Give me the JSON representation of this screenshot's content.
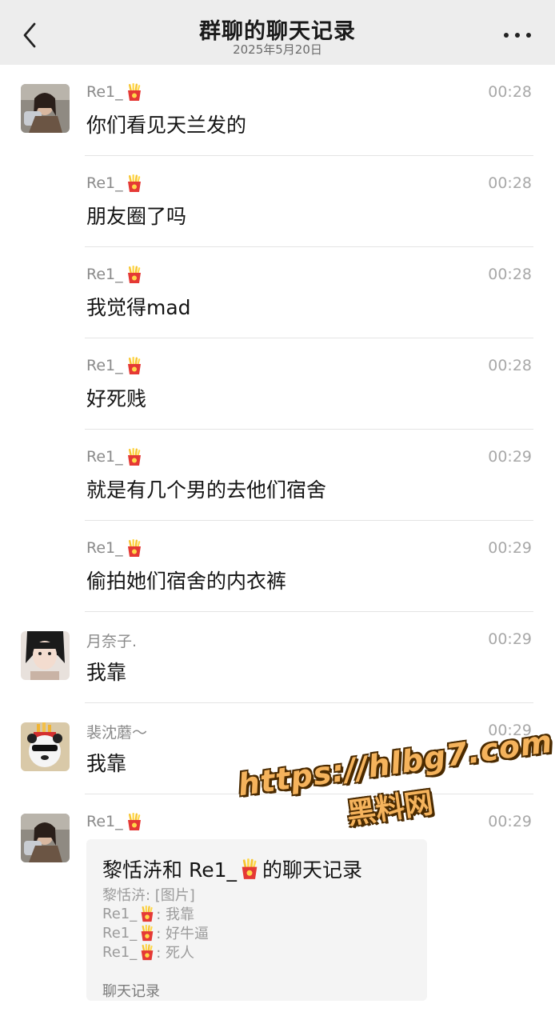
{
  "header": {
    "title": "群聊的聊天记录",
    "date": "2025年5月20日"
  },
  "icons": {
    "back": "back-chevron-icon",
    "more": "more-dots-icon",
    "name_emoji": "fries-icon"
  },
  "messages": [
    {
      "sender": "Re1_",
      "time": "00:28",
      "text": "你们看见天兰发的",
      "show_avatar": true,
      "avatar": "girl-photo-avatar"
    },
    {
      "sender": "Re1_",
      "time": "00:28",
      "text": "朋友圈了吗",
      "show_avatar": false
    },
    {
      "sender": "Re1_",
      "time": "00:28",
      "text": "我觉得mad",
      "show_avatar": false
    },
    {
      "sender": "Re1_",
      "time": "00:28",
      "text": "好死贱",
      "show_avatar": false
    },
    {
      "sender": "Re1_",
      "time": "00:29",
      "text": "就是有几个男的去他们宿舍",
      "show_avatar": false
    },
    {
      "sender": "Re1_",
      "time": "00:29",
      "text": "偷拍她们宿舍的内衣裤",
      "show_avatar": false
    },
    {
      "sender": "月奈子.",
      "time": "00:29",
      "text": "我靠",
      "show_avatar": true,
      "avatar": "anime-girl-avatar"
    },
    {
      "sender": "裴沈蘑～",
      "time": "00:29",
      "text": "我靠",
      "show_avatar": true,
      "avatar": "panda-avatar"
    },
    {
      "sender": "Re1_",
      "time": "00:29",
      "text": "",
      "show_avatar": true,
      "avatar": "girl-photo-avatar"
    }
  ],
  "forward_card": {
    "title_prefix": "黎恬泋和 Re1_",
    "title_suffix": "的聊天记录",
    "lines": [
      {
        "prefix": "黎恬泋: [图片]",
        "has_emoji": false,
        "suffix": ""
      },
      {
        "prefix": "Re1_",
        "has_emoji": true,
        "suffix": ": 我靠"
      },
      {
        "prefix": "Re1_",
        "has_emoji": true,
        "suffix": ": 好牛逼"
      },
      {
        "prefix": "Re1_",
        "has_emoji": true,
        "suffix": ": 死人"
      }
    ],
    "footer": "聊天记录"
  },
  "watermark": {
    "url": "https://hlbg7.com",
    "label": "黑料网"
  },
  "colors": {
    "header_bg": "#ededed",
    "card_bg": "#f4f4f4",
    "watermark": "#f5b35c"
  }
}
